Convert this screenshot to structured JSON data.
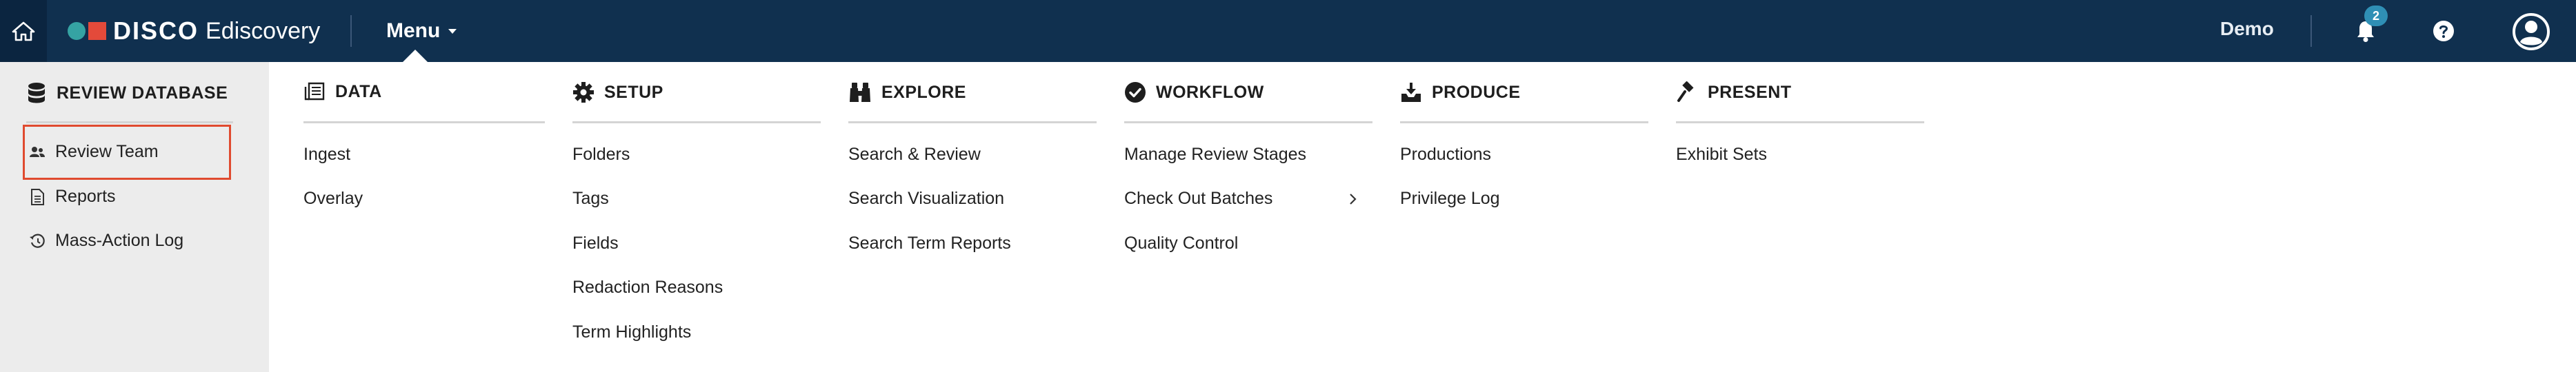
{
  "topbar": {
    "brand": "DISCO",
    "product": "Ediscovery",
    "menu_label": "Menu",
    "user_label": "Demo",
    "notification_count": "2"
  },
  "left_panel": {
    "title": "REVIEW DATABASE",
    "items": [
      {
        "label": "Review Team",
        "icon": "users-icon",
        "selected": true
      },
      {
        "label": "Reports",
        "icon": "document-icon"
      },
      {
        "label": "Mass-Action Log",
        "icon": "history-icon"
      }
    ]
  },
  "columns": [
    {
      "title": "DATA",
      "icon": "data-icon",
      "items": [
        "Ingest",
        "Overlay"
      ]
    },
    {
      "title": "SETUP",
      "icon": "gear-icon",
      "items": [
        "Folders",
        "Tags",
        "Fields",
        "Redaction Reasons",
        "Term Highlights"
      ]
    },
    {
      "title": "EXPLORE",
      "icon": "binoculars-icon",
      "items": [
        "Search & Review",
        "Search Visualization",
        "Search Term Reports"
      ]
    },
    {
      "title": "WORKFLOW",
      "icon": "check-circle-icon",
      "items": [
        "Manage Review Stages",
        "Check Out Batches",
        "Quality Control"
      ]
    },
    {
      "title": "PRODUCE",
      "icon": "download-tray-icon",
      "items": [
        "Productions",
        "Privilege Log"
      ]
    },
    {
      "title": "PRESENT",
      "icon": "gavel-icon",
      "items": [
        "Exhibit Sets"
      ]
    }
  ],
  "colors": {
    "topbar": "#10304f",
    "selection_border": "#e04a2f",
    "badge": "#2f8fb5"
  }
}
